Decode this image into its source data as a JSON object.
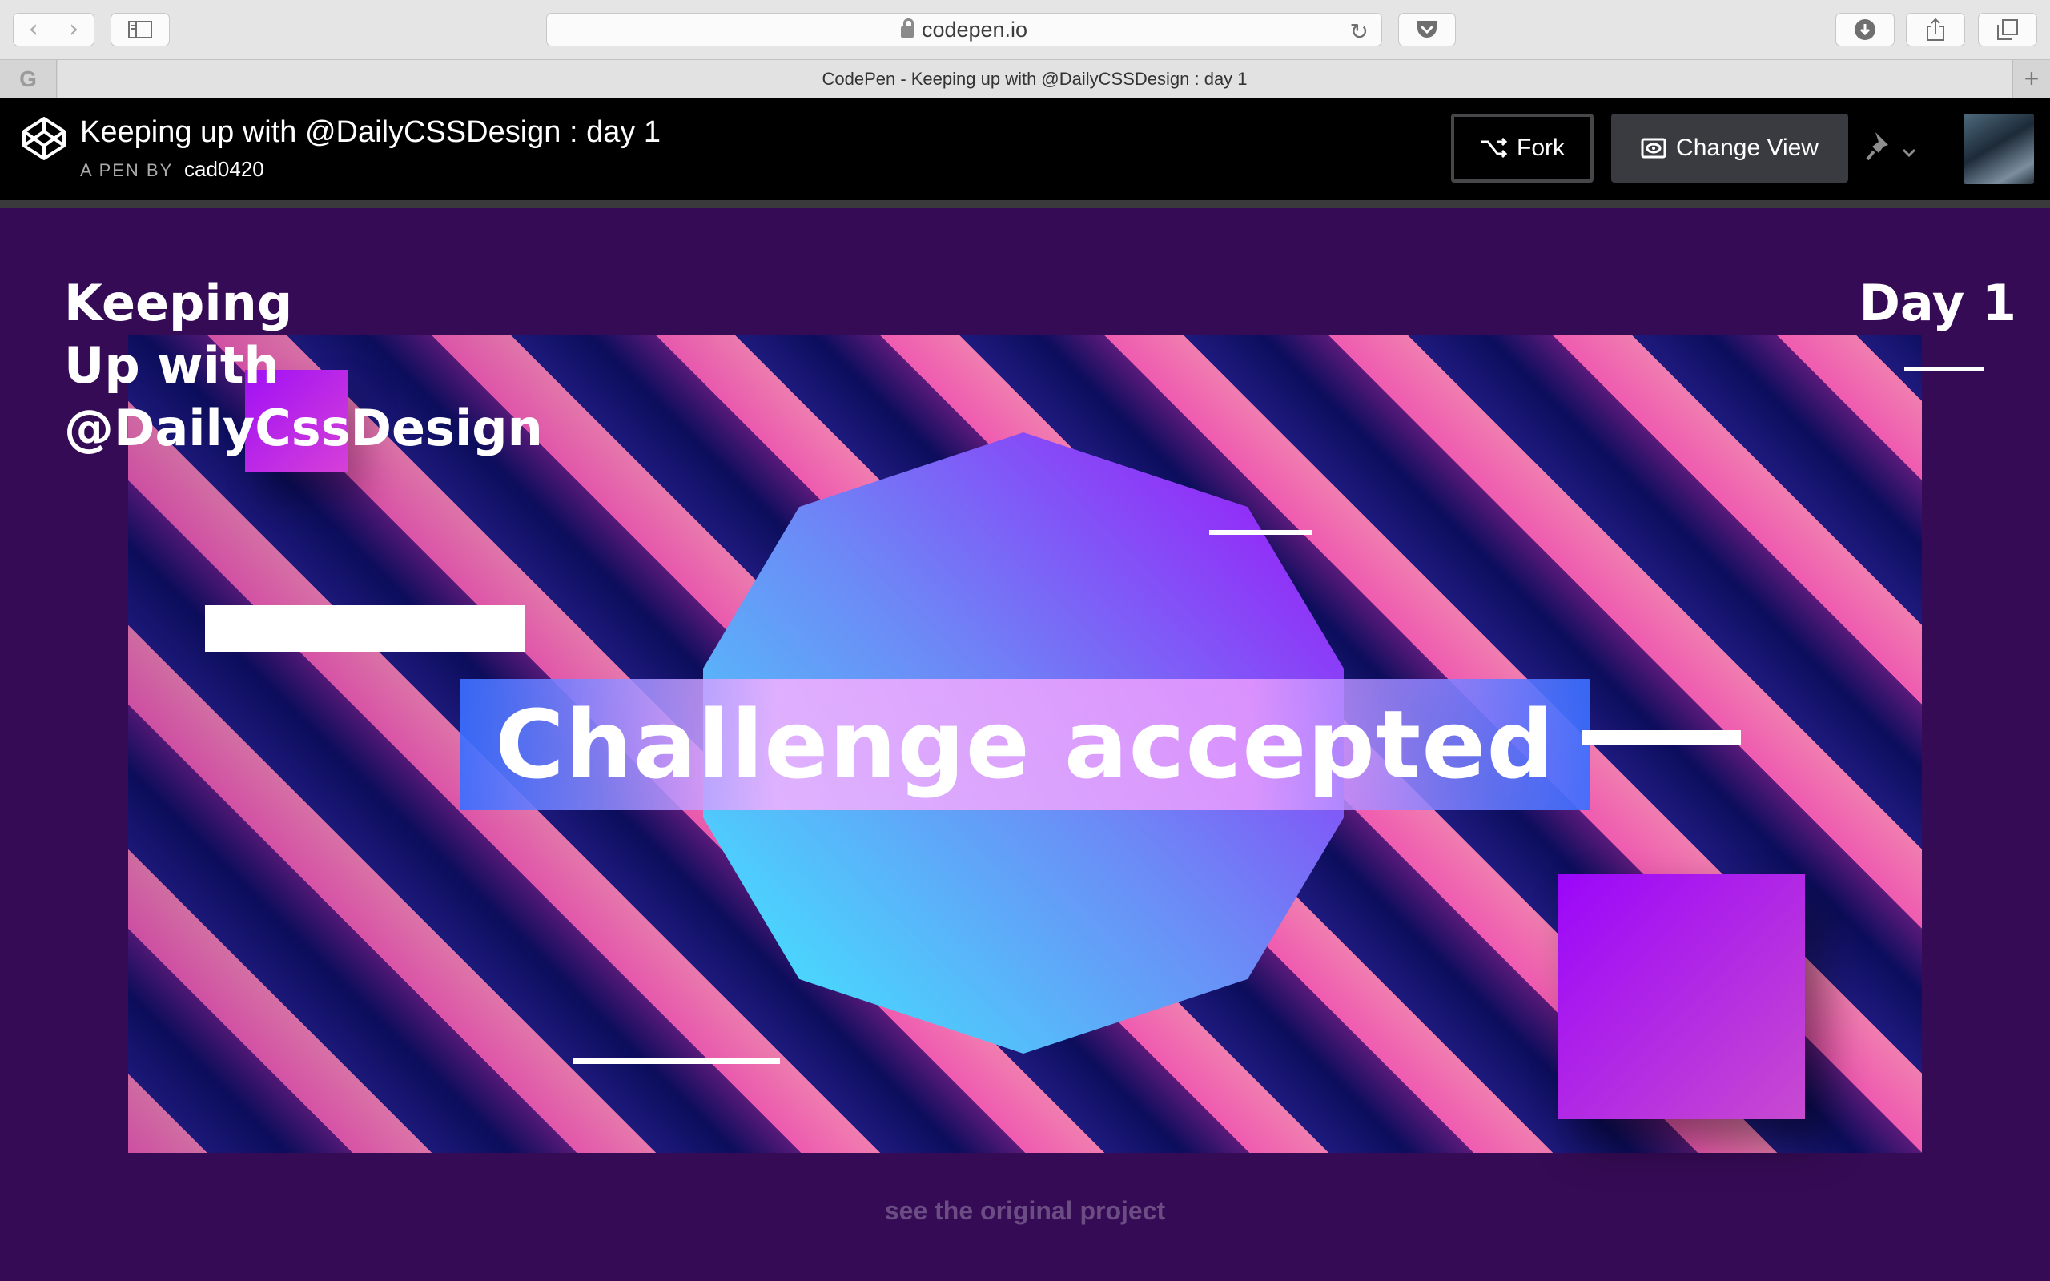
{
  "browser": {
    "url": "codepen.io",
    "tab_title": "CodePen - Keeping up with @DailyCSSDesign : day 1",
    "pinned_tab_label": "G",
    "nav_back": "‹",
    "nav_forward": "›",
    "new_tab": "+"
  },
  "codepen": {
    "pen_title": "Keeping up with @DailyCSSDesign : day 1",
    "pen_by_label": "A PEN BY",
    "author": "cad0420",
    "fork_label": "Fork",
    "change_view_label": "Change View"
  },
  "pen": {
    "title_lines": [
      "Keeping",
      "Up with",
      "@DailyCssDesign"
    ],
    "day_label": "Day 1",
    "headline": "Challenge accepted",
    "link_text": "see the original project",
    "colors": {
      "background": "#360b56",
      "stripe_pink": "#ef5bb0",
      "stripe_navy": "#0c0d5c",
      "octagon_top": "#9f0df8",
      "octagon_bottom": "#3ef0ff",
      "square": "#9b06fa"
    }
  },
  "icons": [
    "lock-icon",
    "reload-icon",
    "pocket-icon",
    "download-icon",
    "share-icon",
    "tabs-icon",
    "sidebar-icon",
    "codepen-logo-icon",
    "fork-icon",
    "eye-icon",
    "pin-icon",
    "chevron-down-icon"
  ]
}
